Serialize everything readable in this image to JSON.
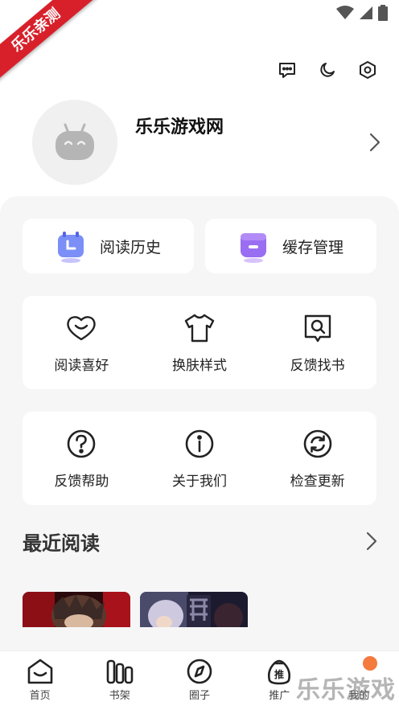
{
  "ribbon": {
    "text": "乐乐亲测"
  },
  "profile": {
    "username": "乐乐游戏网"
  },
  "quick_actions": [
    {
      "label": "阅读历史",
      "icon": "clock-calendar-icon"
    },
    {
      "label": "缓存管理",
      "icon": "cache-box-icon"
    }
  ],
  "grid_row1": [
    {
      "label": "阅读喜好",
      "icon": "heart-smile-icon"
    },
    {
      "label": "换肤样式",
      "icon": "shirt-icon"
    },
    {
      "label": "反馈找书",
      "icon": "book-search-icon"
    }
  ],
  "grid_row2": [
    {
      "label": "反馈帮助",
      "icon": "question-circle-icon"
    },
    {
      "label": "关于我们",
      "icon": "info-circle-icon"
    },
    {
      "label": "检查更新",
      "icon": "refresh-circle-icon"
    }
  ],
  "recent": {
    "title": "最近阅读"
  },
  "bottom_nav": [
    {
      "label": "首页",
      "icon": "home-icon"
    },
    {
      "label": "书架",
      "icon": "bookshelf-icon"
    },
    {
      "label": "圈子",
      "icon": "compass-icon"
    },
    {
      "label": "推广",
      "icon": "promo-bag-icon",
      "badge_text": "推"
    },
    {
      "label": "我的",
      "icon": "profile-icon"
    }
  ],
  "watermark": {
    "text": "乐乐游戏"
  },
  "colors": {
    "accent_purple": "#7b6cf6",
    "ribbon_red": "#d8202b",
    "badge_orange": "#f47a3d",
    "panel_bg": "#f6f6f7"
  }
}
